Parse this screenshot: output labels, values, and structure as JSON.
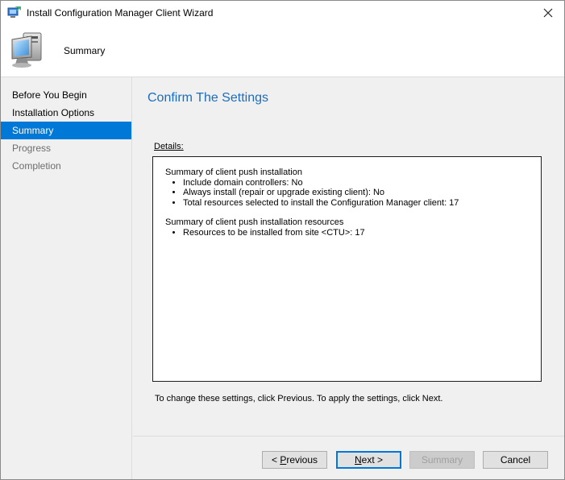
{
  "window": {
    "title": "Install Configuration Manager Client Wizard"
  },
  "header": {
    "title": "Summary"
  },
  "nav": {
    "items": [
      {
        "label": "Before You Begin",
        "state": "normal"
      },
      {
        "label": "Installation Options",
        "state": "normal"
      },
      {
        "label": "Summary",
        "state": "active"
      },
      {
        "label": "Progress",
        "state": "disabled"
      },
      {
        "label": "Completion",
        "state": "disabled"
      }
    ]
  },
  "content": {
    "title": "Confirm The Settings",
    "details_label": "Details:",
    "sections": [
      {
        "heading": "Summary of client push installation",
        "bullets": [
          "Include domain controllers: No",
          "Always install (repair or upgrade existing client): No",
          "Total resources selected to install the Configuration Manager client:  17"
        ]
      },
      {
        "heading": "Summary of client push installation resources",
        "bullets": [
          "Resources to be installed from site <CTU>: 17"
        ]
      }
    ],
    "hint": "To change these settings, click Previous. To apply the settings, click Next."
  },
  "buttons": {
    "previous_prefix": "< ",
    "previous_mnemonic": "P",
    "previous_rest": "revious",
    "next_mnemonic": "N",
    "next_rest": "ext >",
    "summary": "Summary",
    "cancel": "Cancel"
  },
  "colors": {
    "accent": "#0078d7",
    "title_blue": "#1c6dba"
  }
}
